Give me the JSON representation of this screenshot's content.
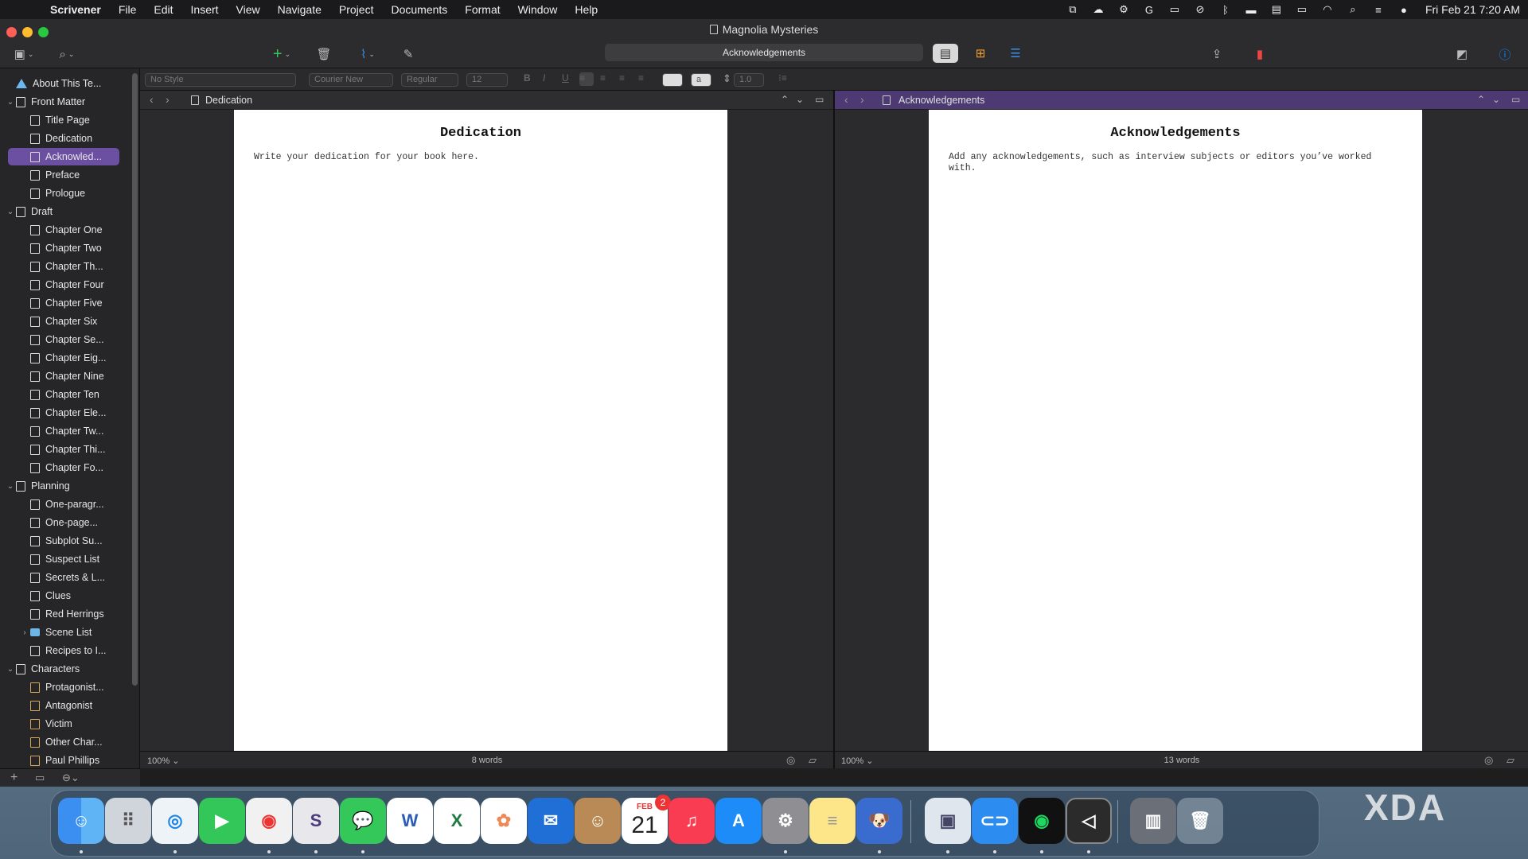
{
  "menubar": {
    "app": "Scrivener",
    "items": [
      "File",
      "Edit",
      "Insert",
      "View",
      "Navigate",
      "Project",
      "Documents",
      "Format",
      "Window",
      "Help"
    ],
    "clock": "Fri Feb 21  7:20 AM"
  },
  "window": {
    "title": "Magnolia Mysteries",
    "search_text": "Acknowledgements"
  },
  "binder": {
    "items": [
      {
        "label": "About This Te...",
        "level": 0,
        "icon": "warning-icon",
        "chevron": ""
      },
      {
        "label": "Front Matter",
        "level": 0,
        "icon": "folder-doc-icon",
        "chevron": "v"
      },
      {
        "label": "Title Page",
        "level": 1,
        "icon": "document-icon",
        "chevron": ""
      },
      {
        "label": "Dedication",
        "level": 1,
        "icon": "document-icon",
        "chevron": ""
      },
      {
        "label": "Acknowled...",
        "level": 1,
        "icon": "document-icon",
        "chevron": "",
        "selected": true
      },
      {
        "label": "Preface",
        "level": 1,
        "icon": "document-icon",
        "chevron": ""
      },
      {
        "label": "Prologue",
        "level": 1,
        "icon": "document-icon",
        "chevron": ""
      },
      {
        "label": "Draft",
        "level": 0,
        "icon": "draft-icon",
        "chevron": "v"
      },
      {
        "label": "Chapter One",
        "level": 1,
        "icon": "document-icon",
        "chevron": ""
      },
      {
        "label": "Chapter Two",
        "level": 1,
        "icon": "document-icon",
        "chevron": ""
      },
      {
        "label": "Chapter Th...",
        "level": 1,
        "icon": "document-icon",
        "chevron": ""
      },
      {
        "label": "Chapter Four",
        "level": 1,
        "icon": "document-icon",
        "chevron": ""
      },
      {
        "label": "Chapter Five",
        "level": 1,
        "icon": "document-icon",
        "chevron": ""
      },
      {
        "label": "Chapter Six",
        "level": 1,
        "icon": "document-icon",
        "chevron": ""
      },
      {
        "label": "Chapter Se...",
        "level": 1,
        "icon": "document-icon",
        "chevron": ""
      },
      {
        "label": "Chapter Eig...",
        "level": 1,
        "icon": "document-icon",
        "chevron": ""
      },
      {
        "label": "Chapter Nine",
        "level": 1,
        "icon": "document-icon",
        "chevron": ""
      },
      {
        "label": "Chapter Ten",
        "level": 1,
        "icon": "document-icon",
        "chevron": ""
      },
      {
        "label": "Chapter Ele...",
        "level": 1,
        "icon": "document-icon",
        "chevron": ""
      },
      {
        "label": "Chapter Tw...",
        "level": 1,
        "icon": "document-icon",
        "chevron": ""
      },
      {
        "label": "Chapter Thi...",
        "level": 1,
        "icon": "document-icon",
        "chevron": ""
      },
      {
        "label": "Chapter Fo...",
        "level": 1,
        "icon": "document-icon",
        "chevron": ""
      },
      {
        "label": "Planning",
        "level": 0,
        "icon": "planning-icon",
        "chevron": "v"
      },
      {
        "label": "One-paragr...",
        "level": 1,
        "icon": "document-icon",
        "chevron": ""
      },
      {
        "label": "One-page...",
        "level": 1,
        "icon": "document-icon",
        "chevron": ""
      },
      {
        "label": "Subplot Su...",
        "level": 1,
        "icon": "document-icon",
        "chevron": ""
      },
      {
        "label": "Suspect List",
        "level": 1,
        "icon": "grid-icon",
        "chevron": ""
      },
      {
        "label": "Secrets & L...",
        "level": 1,
        "icon": "document-icon",
        "chevron": ""
      },
      {
        "label": "Clues",
        "level": 1,
        "icon": "document-icon",
        "chevron": ""
      },
      {
        "label": "Red Herrings",
        "level": 1,
        "icon": "document-icon",
        "chevron": ""
      },
      {
        "label": "Scene List",
        "level": 1,
        "icon": "folder-icon",
        "chevron": ">"
      },
      {
        "label": "Recipes to I...",
        "level": 1,
        "icon": "document-icon",
        "chevron": ""
      },
      {
        "label": "Characters",
        "level": 0,
        "icon": "mask-icon",
        "chevron": "v"
      },
      {
        "label": "Protagonist...",
        "level": 1,
        "icon": "character-icon",
        "chevron": ""
      },
      {
        "label": "Antagonist",
        "level": 1,
        "icon": "character-icon",
        "chevron": ""
      },
      {
        "label": "Victim",
        "level": 1,
        "icon": "character-icon",
        "chevron": ""
      },
      {
        "label": "Other Char...",
        "level": 1,
        "icon": "character-icon",
        "chevron": ""
      },
      {
        "label": "Paul Phillips",
        "level": 1,
        "icon": "character-icon",
        "chevron": ""
      }
    ]
  },
  "format_bar": {
    "style": "No Style",
    "font": "Courier New",
    "weight": "Regular",
    "size": "12",
    "bold": "B",
    "italic": "I",
    "underline": "U",
    "line_spacing": "1.0",
    "highlight_glyph": "a"
  },
  "left_editor": {
    "header_title": "Dedication",
    "doc_title": "Dedication",
    "doc_body": "Write your dedication for your book here.",
    "zoom": "100%",
    "word_count": "8 words"
  },
  "right_editor": {
    "header_title": "Acknowledgements",
    "doc_title": "Acknowledgements",
    "doc_body": "Add any acknowledgements, such as interview subjects or editors you’ve worked with.",
    "zoom": "100%",
    "word_count": "13 words"
  },
  "dock": {
    "calendar_month": "FEB",
    "calendar_day": "21",
    "calendar_badge": "2",
    "apps": [
      "finder",
      "launchpad",
      "safari",
      "facetime",
      "chrome",
      "scrivener",
      "messages",
      "word",
      "excel",
      "photos",
      "thunderbird",
      "contacts",
      "calendar",
      "music",
      "app-store",
      "system-settings",
      "notes",
      "bitwarden-like",
      "preview",
      "tailscale",
      "spotify",
      "remote-desktop",
      "archive",
      "trash"
    ]
  },
  "watermark": "XDA",
  "colors": {
    "selection": "#6b4fa1",
    "right_header": "#4d3a73",
    "accent_blue": "#0a84ff"
  }
}
